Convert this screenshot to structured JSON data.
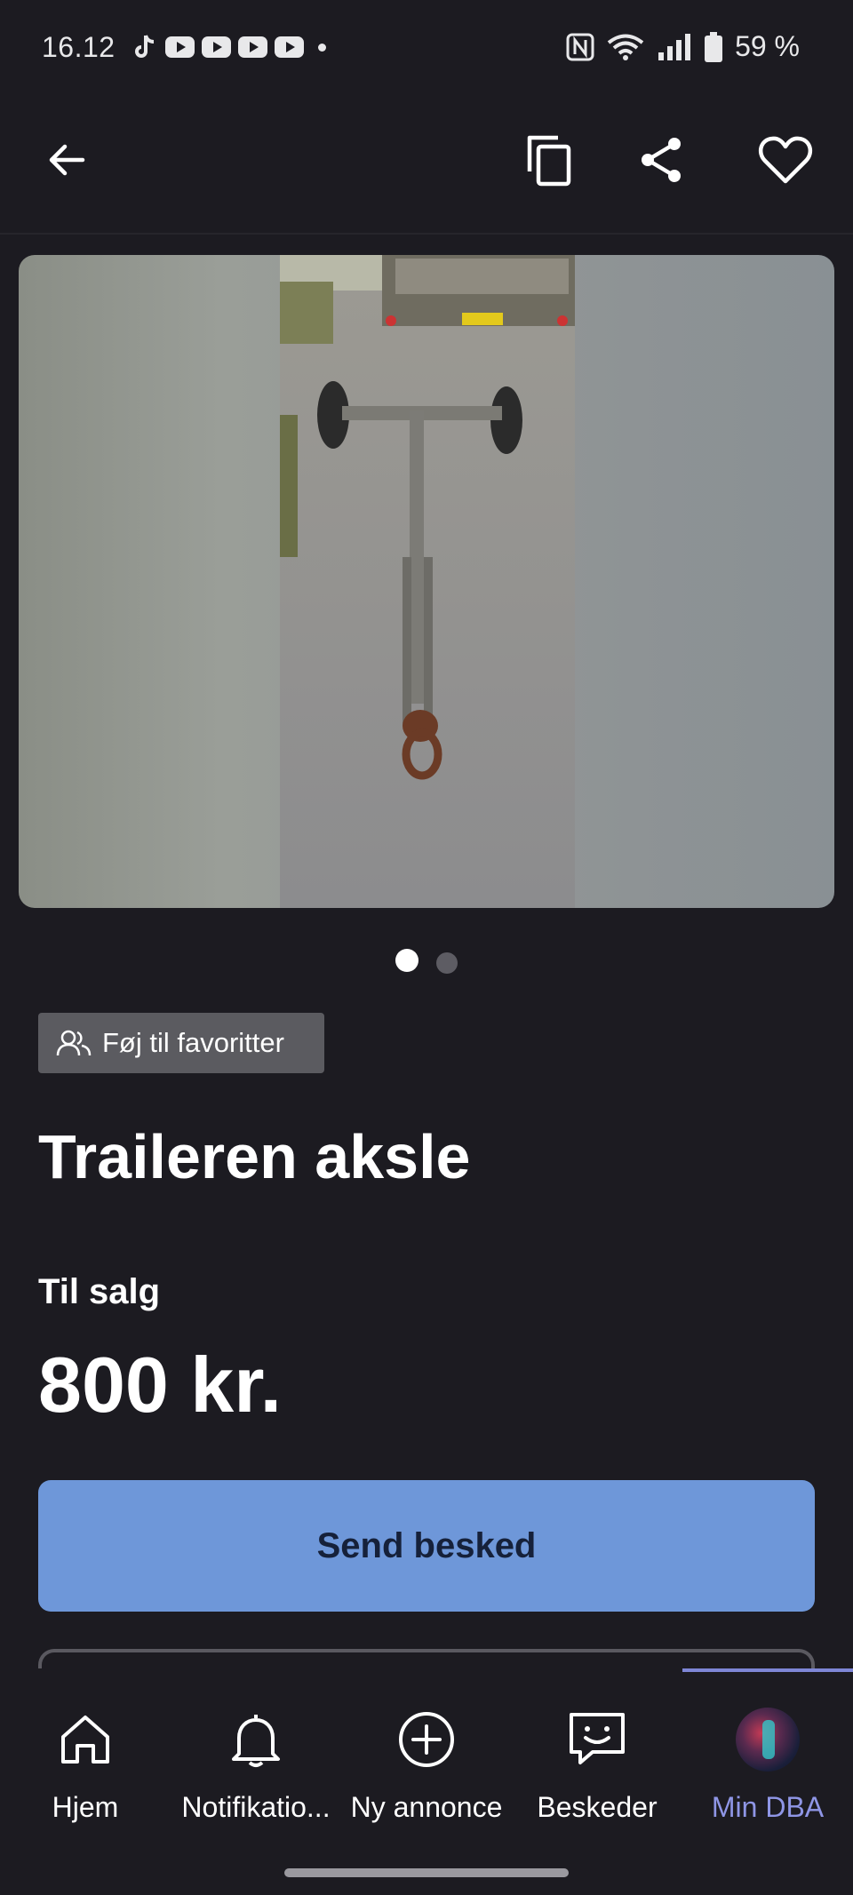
{
  "status": {
    "time": "16.12",
    "battery": "59 %"
  },
  "ad": {
    "favorite_label": "Føj til favoritter",
    "title": "Traileren aksle",
    "sale_type": "Til salg",
    "price": "800 kr.",
    "send_label": "Send besked",
    "image_count": 2,
    "active_image": 1
  },
  "nav": {
    "items": [
      {
        "label": "Hjem",
        "icon": "home-icon"
      },
      {
        "label": "Notifikatio...",
        "icon": "bell-icon"
      },
      {
        "label": "Ny annonce",
        "icon": "plus-circle-icon"
      },
      {
        "label": "Beskeder",
        "icon": "chat-icon"
      },
      {
        "label": "Min DBA",
        "icon": "avatar"
      }
    ],
    "active": "Min DBA"
  },
  "colors": {
    "background": "#1c1b21",
    "primary_button": "#6e97d9",
    "active_nav": "#8f96e6"
  }
}
